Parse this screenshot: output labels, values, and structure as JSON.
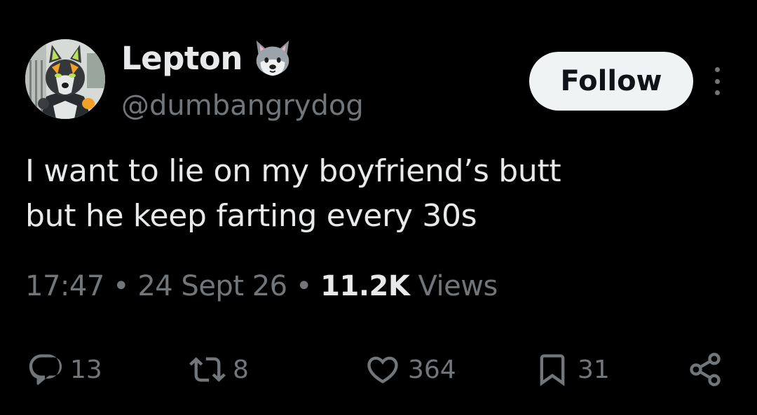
{
  "author": {
    "display_name": "Lepton",
    "name_emoji": "wolf-face-icon",
    "handle": "@dumbangrydog"
  },
  "follow_button": {
    "label": "Follow"
  },
  "tweet": {
    "line1": "I want to lie on my boyfriend’s butt",
    "line2": "but he keep farting every 30s"
  },
  "meta": {
    "time": "17:47",
    "separator": " • ",
    "date": "24 Sept 26",
    "views_count": "11.2K",
    "views_label": " Views"
  },
  "actions": {
    "replies": "13",
    "reposts": "8",
    "likes": "364",
    "bookmarks": "31"
  },
  "colors": {
    "background": "#000000",
    "primary_text": "#e7e9ea",
    "secondary_text": "#71767b",
    "follow_bg": "#eff3f4",
    "follow_text": "#0f1419"
  }
}
